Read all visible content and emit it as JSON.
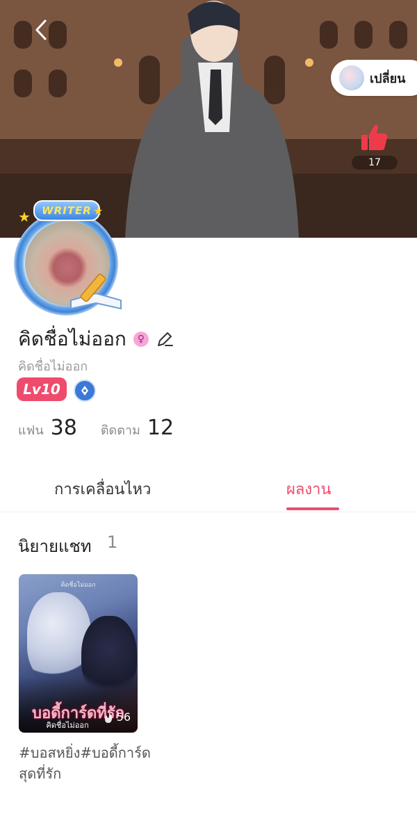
{
  "header": {
    "switch_label": "เปลี่ยน",
    "like_count": "17"
  },
  "profile": {
    "writer_badge": "WRITER",
    "username": "คิดชื่อไม่ออก",
    "subname": "คิดชื่อไม่ออก",
    "level": "Lv10",
    "stats": {
      "fans_label": "แฟน",
      "fans_value": "38",
      "following_label": "ติดตาม",
      "following_value": "12"
    }
  },
  "tabs": [
    {
      "label": "การเคลื่อนไหว",
      "active": false
    },
    {
      "label": "ผลงาน",
      "active": true
    }
  ],
  "section": {
    "title": "นิยายแชท",
    "count": "1"
  },
  "works": [
    {
      "cover_author": "คิดชื่อไม่ออก",
      "cover_title": "บอดี้การ์ดที่รัก",
      "cover_subtitle": "คิดชื่อไม่ออก",
      "views": "56",
      "caption": "#บอสหยิ่ง#บอดี้การ์ดสุดที่รัก"
    }
  ],
  "colors": {
    "accent": "#ee4b6d",
    "level_badge": "#ee4b6d",
    "like": "#ee3b4b"
  }
}
